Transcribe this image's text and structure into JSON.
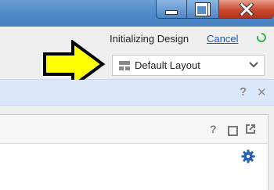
{
  "window": {
    "minimize_icon": "minimize-icon",
    "maximize_icon": "restore-window-icon",
    "close_icon": "close-icon"
  },
  "toolbar": {
    "status_text": "Initializing Design",
    "cancel_label": "Cancel",
    "spinner_icon": "loading-spinner-icon",
    "layout_select": {
      "selected": "Default Layout",
      "icon": "layout-grid-icon"
    }
  },
  "info_bar": {
    "help_icon": "question-mark-icon",
    "close_icon": "close-icon"
  },
  "panel": {
    "help_icon": "question-mark-icon",
    "restore_icon": "restore-icon",
    "popout_icon": "popout-icon",
    "settings_icon": "gear-icon"
  },
  "annotation": {
    "arrow_icon": "yellow-arrow-icon"
  },
  "colors": {
    "title_bar": "#4d87c7",
    "close_button": "#c84a31",
    "info_bar": "#dbe8fb",
    "link": "#1a55c8",
    "arrow_fill": "#ffff00",
    "gear": "#1f5fb4",
    "spinner": "#3cb043"
  }
}
